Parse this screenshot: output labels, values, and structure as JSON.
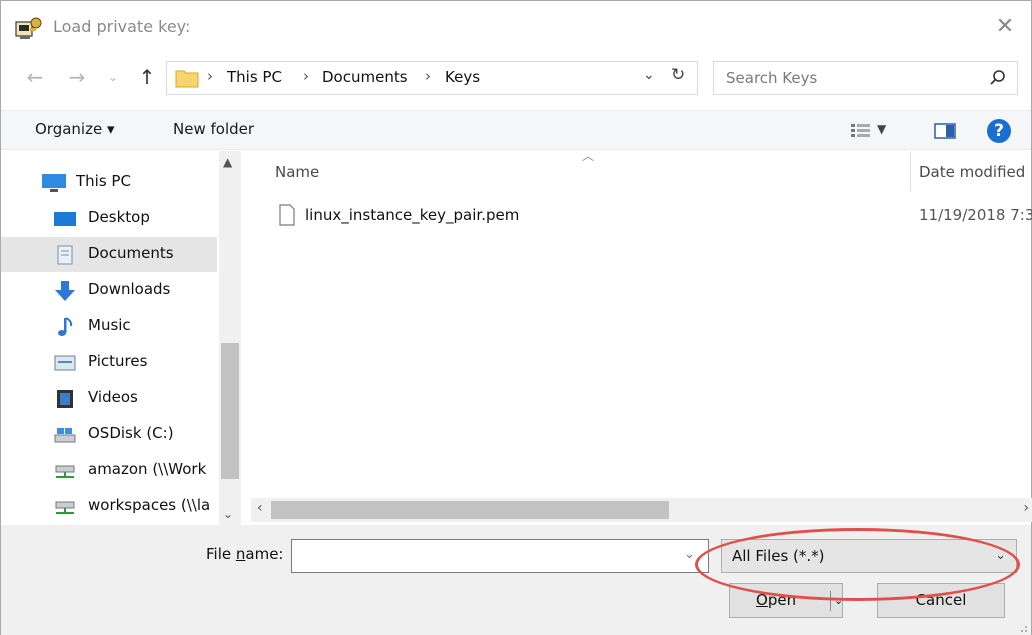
{
  "window": {
    "title": "Load private key:"
  },
  "address": {
    "crumbs": [
      "This PC",
      "Documents",
      "Keys"
    ],
    "search_placeholder": "Search Keys"
  },
  "toolbar": {
    "organize": "Organize ▾",
    "new_folder": "New folder"
  },
  "nav": {
    "items": [
      {
        "label": "This PC",
        "icon": "monitor-icon"
      },
      {
        "label": "Desktop",
        "icon": "desktop-icon"
      },
      {
        "label": "Documents",
        "icon": "documents-icon",
        "selected": true
      },
      {
        "label": "Downloads",
        "icon": "download-icon"
      },
      {
        "label": "Music",
        "icon": "music-icon"
      },
      {
        "label": "Pictures",
        "icon": "pictures-icon"
      },
      {
        "label": "Videos",
        "icon": "videos-icon"
      },
      {
        "label": "OSDisk (C:)",
        "icon": "drive-icon"
      },
      {
        "label": "amazon (\\\\Work",
        "icon": "network-drive-icon"
      },
      {
        "label": "workspaces (\\\\la",
        "icon": "network-drive-icon"
      }
    ]
  },
  "files": {
    "columns": [
      "Name",
      "Date modified"
    ],
    "rows": [
      {
        "name": "linux_instance_key_pair.pem",
        "date": "11/19/2018 7:3"
      }
    ]
  },
  "bottom": {
    "file_name_label_pre": "File ",
    "file_name_label_ul": "n",
    "file_name_label_post": "ame:",
    "file_name_value": "",
    "filter": "All Files (*.*)",
    "open_pre": "",
    "open_ul": "O",
    "open_post": "pen",
    "cancel": "Cancel"
  },
  "colors": {
    "accent": "#1a6fd1",
    "annotation": "#e0504a",
    "selected": "#e5e5e5"
  }
}
